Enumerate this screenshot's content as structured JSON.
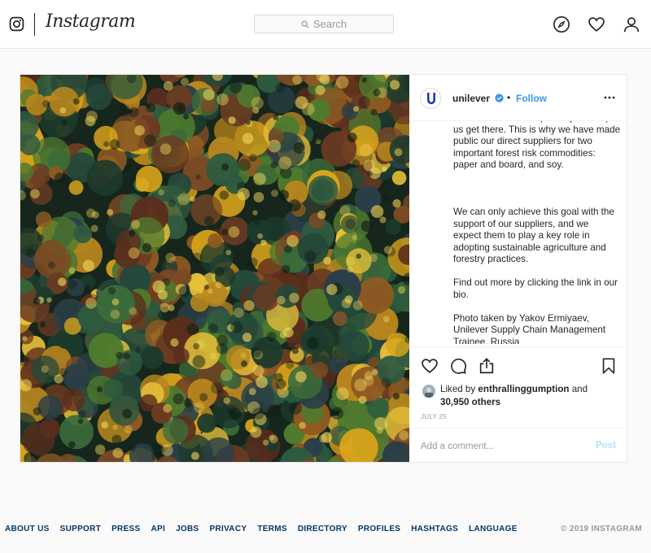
{
  "app": {
    "name": "Instagram",
    "search_placeholder": "Search"
  },
  "nav_icons": [
    "instagram-logo-icon",
    "compass-icon",
    "heart-icon",
    "user-icon"
  ],
  "post": {
    "account": {
      "username": "unilever",
      "avatar_text": "Unilever",
      "verified": true,
      "separator": "•",
      "follow_label": "Follow"
    },
    "caption": {
      "paragraphs": [
        "we believe that transparency will help\nus get there. This is why we have made\npublic our direct suppliers for two\nimportant forest risk commodities:\npaper and board, and soy.",
        "",
        "We can only achieve this goal with the\nsupport of our suppliers, and we\nexpect them to play a key role in\nadopting sustainable agriculture and\nforestry practices.",
        "Find out more by clicking the link in our\nbio.",
        "Photo taken by Yakov Ermiyaev,\nUnilever Supply Chain Management\nTrainee, Russia"
      ]
    },
    "likes": {
      "prefix": "Liked by",
      "user": "enthrallinggumption",
      "and": "and",
      "count": "30,950 others"
    },
    "date": "JULY 25",
    "comment_placeholder": "Add a comment...",
    "post_label": "Post"
  },
  "footer": {
    "links": [
      "ABOUT US",
      "SUPPORT",
      "PRESS",
      "API",
      "JOBS",
      "PRIVACY",
      "TERMS",
      "DIRECTORY",
      "PROFILES",
      "HASHTAGS",
      "LANGUAGE"
    ],
    "copyright": "© 2019 INSTAGRAM"
  },
  "colors": {
    "link_blue": "#3897f0",
    "footer_link": "#003569",
    "border": "#e6e6e6"
  }
}
